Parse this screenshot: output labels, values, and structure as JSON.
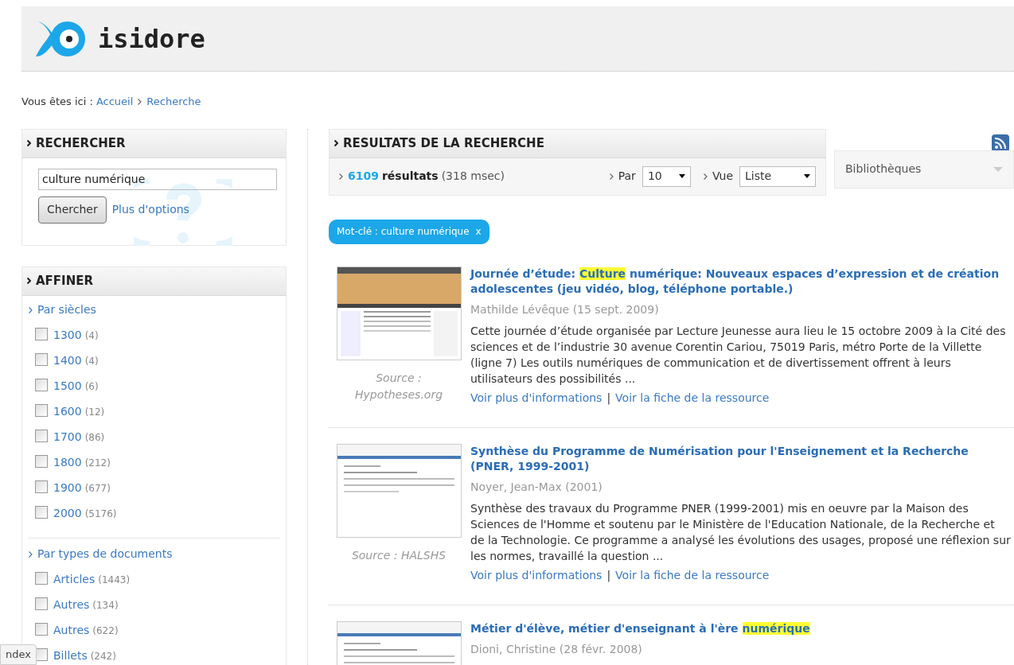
{
  "logo": {
    "text": "isidore"
  },
  "breadcrumb": {
    "label": "Vous êtes ici :",
    "links": [
      {
        "text": "Accueil"
      },
      {
        "text": "Recherche"
      }
    ]
  },
  "search_panel": {
    "title": "RECHERCHER",
    "value": "culture numérique",
    "button": "Chercher",
    "more_link": "Plus d'options"
  },
  "refine_panel": {
    "title": "AFFINER",
    "groups": [
      {
        "title": "Par siècles",
        "items": [
          {
            "label": "1300",
            "count": "(4)",
            "checked": false
          },
          {
            "label": "1400",
            "count": "(4)",
            "checked": false
          },
          {
            "label": "1500",
            "count": "(6)",
            "checked": false
          },
          {
            "label": "1600",
            "count": "(12)",
            "checked": false
          },
          {
            "label": "1700",
            "count": "(86)",
            "checked": false
          },
          {
            "label": "1800",
            "count": "(212)",
            "checked": false
          },
          {
            "label": "1900",
            "count": "(677)",
            "checked": false
          },
          {
            "label": "2000",
            "count": "(5176)",
            "checked": false
          }
        ]
      },
      {
        "title": "Par types de documents",
        "items": [
          {
            "label": "Articles",
            "count": "(1443)",
            "checked": false
          },
          {
            "label": "Autres",
            "count": "(134)",
            "checked": false
          },
          {
            "label": "Autres",
            "count": "(622)",
            "checked": false
          },
          {
            "label": "Billets",
            "count": "(242)",
            "checked": false
          }
        ]
      }
    ]
  },
  "results_panel": {
    "title": "RESULTATS DE LA RECHERCHE",
    "count": "6109",
    "count_label": "résultats",
    "time": "(318 msec)",
    "per_page_label": "Par",
    "per_page": "10",
    "view_label": "Vue",
    "view": "Liste",
    "library_select": "Bibliothèques"
  },
  "filter_tag": {
    "text": "Mot-clé : culture numérique",
    "remove": "x"
  },
  "results": [
    {
      "title": [
        {
          "text": "Journée d’étude: ",
          "highlight": false
        },
        {
          "text": "Culture",
          "highlight": true
        },
        {
          "text": " numérique: Nouveaux espaces d’expression et de création adolescentes (jeu vidéo, blog, téléphone portable.)",
          "highlight": false
        }
      ],
      "author": "Mathilde Lévêque (15 sept. 2009)",
      "description": "Cette journée d’étude organisée par Lecture Jeunesse aura lieu le 15 octobre 2009 à la Cité des sciences et de l’industrie 30 avenue Corentin Cariou, 75019 Paris, métro Porte de la Villette (ligne 7) Les outils numériques de communication et de divertissement offrent à leurs utilisateurs des possibilités ...",
      "source": "Source : Hypotheses.org",
      "links": [
        "Voir plus d'informations",
        "Voir la fiche de la ressource"
      ],
      "separator": "|",
      "kind": "blog"
    },
    {
      "title": [
        {
          "text": "Synthèse du Programme de Numérisation pour l'Enseignement et la Recherche (PNER, 1999-2001)",
          "highlight": false
        }
      ],
      "author": "Noyer, Jean-Max (2001)",
      "description": "Synthèse des travaux du Programme PNER (1999-2001) mis en oeuvre par la Maison des Sciences de l'Homme et soutenu par le Ministère de l'Education Nationale, de la Recherche et de la Technologie. Ce programme a analysé les évolutions des usages, proposé une réflexion sur les normes, travaillé la question ...",
      "source": "Source : HALSHS",
      "links": [
        "Voir plus d'informations",
        "Voir la fiche de la ressource"
      ],
      "separator": "|",
      "kind": "archive"
    },
    {
      "title": [
        {
          "text": "Métier d'élève, métier d'enseignant à l'ère ",
          "highlight": false
        },
        {
          "text": "numérique",
          "highlight": true
        }
      ],
      "author": "Dioni, Christine (28 févr. 2008)",
      "kind": "archive"
    }
  ],
  "tooltip": {
    "text": "ndex"
  }
}
